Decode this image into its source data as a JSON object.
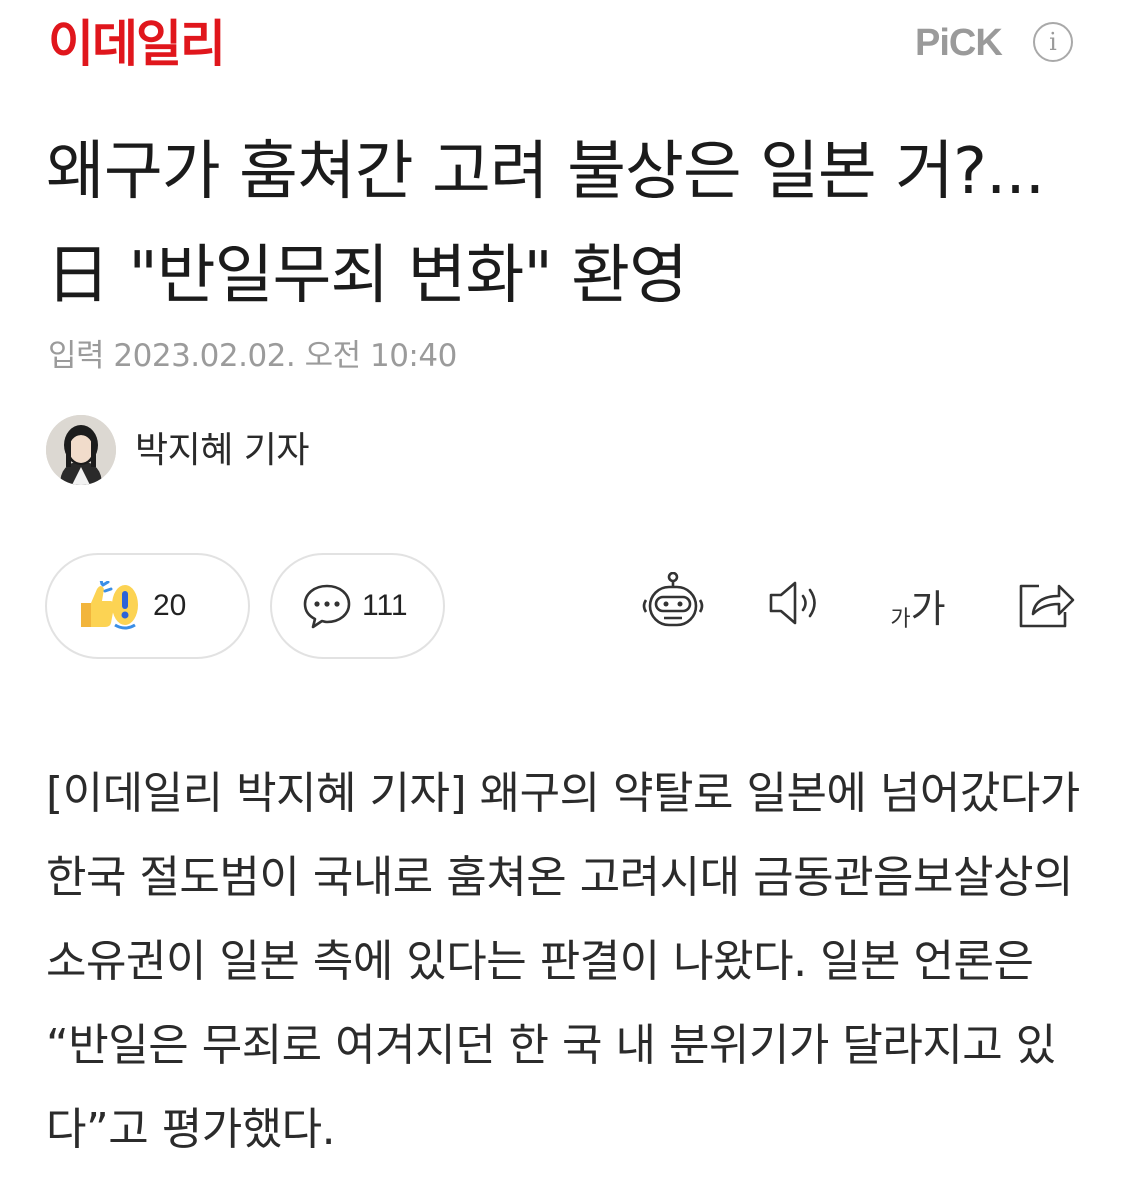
{
  "header": {
    "logo": "이데일리",
    "pick_label": "PiCK",
    "info_icon": "i"
  },
  "article": {
    "title": "왜구가 훔쳐간 고려 불상은 일본 거?...日 \"반일무죄 변화\" 환영",
    "date": "입력 2023.02.02. 오전 10:40",
    "author": "박지혜 기자",
    "body": "[이데일리 박지혜 기자] 왜구의 약탈로 일본에 넘어갔다가 한국 절도범이 국내로 훔쳐온 고려시대 금동관음보살상의 소유권이 일본 측에 있다는 판결이 나왔다. 일본 언론은 “반일은 무죄로 여겨지던 한 국 내 분위기가 달라지고 있다”고 평가했다."
  },
  "actions": {
    "reaction_count": "20",
    "comment_count": "111",
    "font_small": "가",
    "font_large": "가"
  },
  "icons": {
    "reaction": "reaction-emoji-icon",
    "comment": "comment-bubble-icon",
    "summary": "robot-summary-icon",
    "audio": "speaker-icon",
    "font": "font-size-icon",
    "share": "share-icon",
    "info": "info-icon"
  },
  "colors": {
    "brand": "#e0161c",
    "muted": "#9b9b9b",
    "border": "#e2e2e2"
  }
}
